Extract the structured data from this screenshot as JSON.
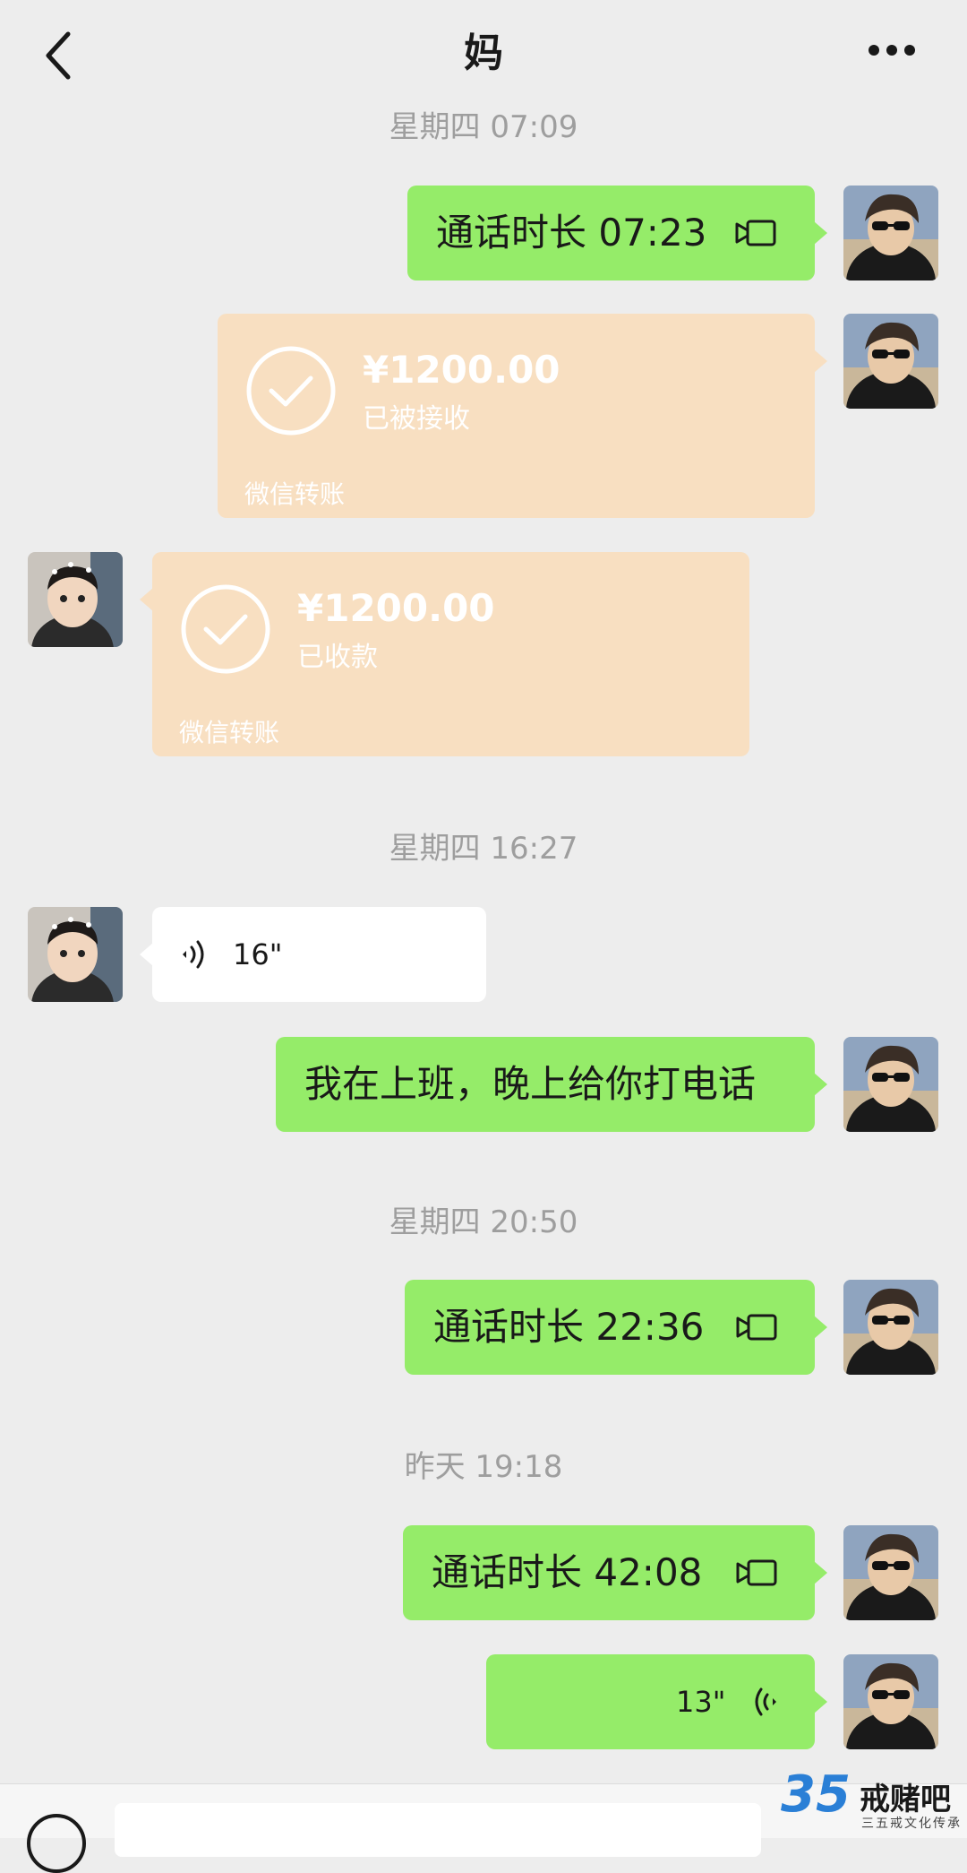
{
  "header": {
    "title": "妈",
    "back_icon": "chevron-left-icon",
    "more_icon": "ellipsis-icon"
  },
  "messages": [
    {
      "kind": "timestamp",
      "text": "星期四 07:09"
    },
    {
      "kind": "call",
      "side": "right",
      "text": "通话时长 07:23",
      "icon": "video-call-icon"
    },
    {
      "kind": "transfer",
      "side": "right",
      "amount": "¥1200.00",
      "status": "已被接收",
      "source": "微信转账"
    },
    {
      "kind": "transfer",
      "side": "left",
      "amount": "¥1200.00",
      "status": "已收款",
      "source": "微信转账"
    },
    {
      "kind": "timestamp",
      "text": "星期四 16:27"
    },
    {
      "kind": "voice",
      "side": "left",
      "duration": "16\""
    },
    {
      "kind": "text",
      "side": "right",
      "text": "我在上班，晚上给你打电话"
    },
    {
      "kind": "timestamp",
      "text": "星期四 20:50"
    },
    {
      "kind": "call",
      "side": "right",
      "text": "通话时长 22:36",
      "icon": "video-call-icon"
    },
    {
      "kind": "timestamp",
      "text": "昨天 19:18"
    },
    {
      "kind": "call",
      "side": "right",
      "text": "通话时长 42:08",
      "icon": "video-call-icon"
    },
    {
      "kind": "voice",
      "side": "right",
      "duration": "13\""
    }
  ],
  "colors": {
    "background": "#ededed",
    "bubble_green": "#95ec69",
    "bubble_transfer": "#f8dfc1",
    "bubble_white": "#ffffff",
    "timestamp": "#9e9e9e"
  },
  "watermark": {
    "number": "35",
    "name": "戒赌吧",
    "tagline": "三五戒文化传承"
  }
}
